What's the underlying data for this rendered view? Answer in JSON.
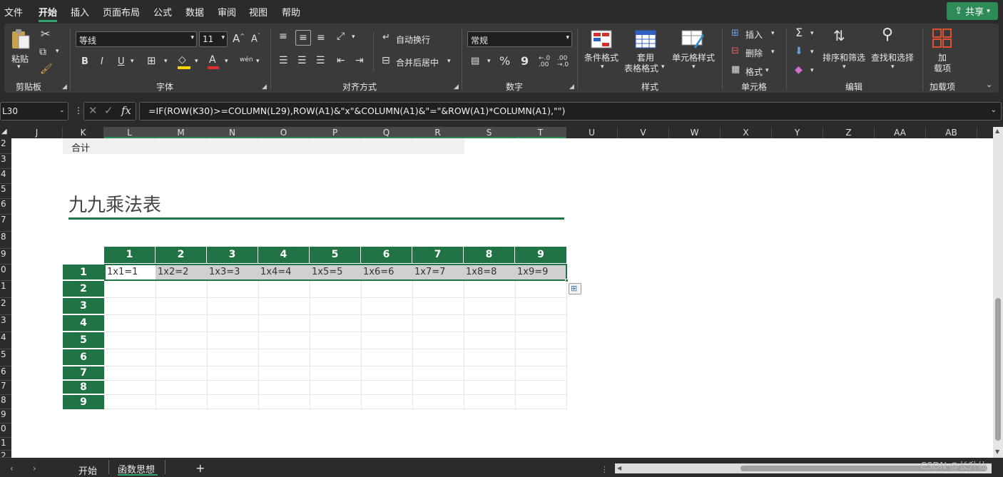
{
  "menu": {
    "items": [
      "文件",
      "开始",
      "插入",
      "页面布局",
      "公式",
      "数据",
      "审阅",
      "视图",
      "帮助"
    ],
    "share_label": "共享"
  },
  "ribbon": {
    "clipboard": {
      "paste": "粘贴",
      "group": "剪贴板"
    },
    "font": {
      "name": "等线",
      "size": "11",
      "group": "字体",
      "bold": "B",
      "italic": "I",
      "underline": "U",
      "grow": "A^",
      "shrink": "Aˇ",
      "phonetic": "wén",
      "font_color_glyph": "A"
    },
    "alignment": {
      "wrap": "自动换行",
      "merge": "合并后居中",
      "group": "对齐方式"
    },
    "number": {
      "format": "常规",
      "group": "数字",
      "percent": "%",
      "comma": "9",
      "inc_dec": "←.0\n.00",
      "dec_dec": ".00\n→.0"
    },
    "styles": {
      "conditional": "条件格式",
      "table_line1": "套用",
      "table_line2": "表格格式",
      "cell_styles": "单元格样式",
      "group": "样式"
    },
    "cells": {
      "insert": "插入",
      "delete": "删除",
      "format": "格式",
      "group": "单元格"
    },
    "editing": {
      "sort": "排序和筛选",
      "find": "查找和选择",
      "group": "编辑",
      "sum_glyph": "Σ"
    },
    "addins": {
      "line1": "加",
      "line2": "载项",
      "group": "加载项"
    }
  },
  "formula_bar": {
    "name_box": "L30",
    "fx": "fx",
    "formula": "=IF(ROW(K30)>=COLUMN(L29),ROW(A1)&\"x\"&COLUMN(A1)&\"=\"&ROW(A1)*COLUMN(A1),\"\")"
  },
  "columns": [
    "J",
    "K",
    "L",
    "M",
    "N",
    "O",
    "P",
    "Q",
    "R",
    "S",
    "T",
    "U",
    "V",
    "W",
    "X",
    "Y",
    "Z",
    "AA",
    "AB"
  ],
  "rows": [
    "2",
    "3",
    "4",
    "5",
    "6",
    "7",
    "8",
    "9",
    "0",
    "1",
    "2",
    "3",
    "4",
    "5",
    "6",
    "7",
    "8",
    "9",
    "0",
    "1",
    "2"
  ],
  "sheet": {
    "total_label": "合计",
    "title": "九九乘法表",
    "col_headers": [
      "1",
      "2",
      "3",
      "4",
      "5",
      "6",
      "7",
      "8",
      "9"
    ],
    "row_headers": [
      "1",
      "2",
      "3",
      "4",
      "5",
      "6",
      "7",
      "8",
      "9"
    ],
    "row1_values": [
      "1x1=1",
      "1x2=2",
      "1x3=3",
      "1x4=4",
      "1x5=5",
      "1x6=6",
      "1x7=7",
      "1x8=8",
      "1x9=9"
    ]
  },
  "tabs": {
    "sheet1": "开始",
    "sheet2": "函数思想",
    "add": "+"
  },
  "watermark": "CSDN @长升仙",
  "colors": {
    "green": "#217346",
    "accent": "#2e8b57"
  }
}
